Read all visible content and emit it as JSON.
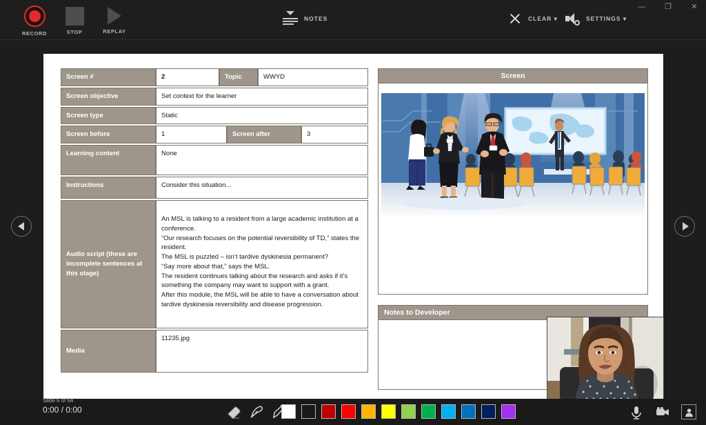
{
  "window": {
    "controls": [
      {
        "name": "minimize",
        "glyph": "—"
      },
      {
        "name": "restore",
        "glyph": "❐"
      },
      {
        "name": "close",
        "glyph": "✕"
      }
    ]
  },
  "toolbar": {
    "record_label": "RECORD",
    "stop_label": "STOP",
    "replay_label": "REPLAY",
    "notes_label": "NOTES",
    "clear_label": "CLEAR ▾",
    "settings_label": "SETTINGS ▾",
    "record_color": "#e8292b"
  },
  "navigation": {
    "prev_label": "Previous slide",
    "next_label": "Next slide"
  },
  "slide": {
    "spec_table": {
      "screen_number_label": "Screen #",
      "screen_number_value": "2",
      "topic_label": "Topic",
      "topic_value": "WWYD",
      "screen_objective_label": "Screen objective",
      "screen_objective_value": "Set context for the learner",
      "screen_type_label": "Screen type",
      "screen_type_value": "Static",
      "screen_before_label": "Screen before",
      "screen_before_value": "1",
      "screen_after_label": "Screen after",
      "screen_after_value": "3",
      "learning_content_label": "Learning content",
      "learning_content_value": "None",
      "instructions_label": "Instructions",
      "instructions_value": "Consider this situation...",
      "audio_script_label": "Audio script (these are incomplete sentences at this stage)",
      "audio_script_value": "An MSL is talking to a resident from a large academic institution at a conference.\n“Our research focuses on the potential reversibility of TD,” states the resident.\nThe MSL is puzzled – isn’t tardive dyskinesia permanent?\n“Say more about that,” says the MSL.\nThe resident continues talking about the research and asks if it’s something the company may want to support with a grant.\nAfter this module, the MSL will be able to have a conversation about tardive dyskinesia reversibility and disease progression.",
      "media_label": "Media",
      "media_value": "11235.jpg"
    },
    "screen_panel": {
      "title": "Screen",
      "illustration_alt": "conference-presentation-illustration"
    },
    "notes_panel": {
      "title": "Notes to Developer",
      "body": ""
    }
  },
  "webcam": {
    "label": "presenter-webcam-feed"
  },
  "statusbar": {
    "slide_counter": "Slide 6 of 64",
    "time_code": "0:00 / 0:00",
    "pen_tools": [
      {
        "name": "eraser-tool"
      },
      {
        "name": "pen-tool"
      },
      {
        "name": "highlighter-tool"
      }
    ],
    "colors": [
      {
        "name": "white",
        "hex": "#ffffff"
      },
      {
        "name": "black",
        "hex": "#1a1a1a"
      },
      {
        "name": "dark-red",
        "hex": "#c00000"
      },
      {
        "name": "red",
        "hex": "#ff0000"
      },
      {
        "name": "orange",
        "hex": "#ffb400"
      },
      {
        "name": "yellow",
        "hex": "#ffff00"
      },
      {
        "name": "light-green",
        "hex": "#92d050"
      },
      {
        "name": "green",
        "hex": "#00b050"
      },
      {
        "name": "light-blue",
        "hex": "#00b0f0"
      },
      {
        "name": "blue",
        "hex": "#0070c0"
      },
      {
        "name": "dark-blue",
        "hex": "#002060"
      },
      {
        "name": "purple",
        "hex": "#a62ef0"
      }
    ],
    "av_tools": [
      {
        "name": "microphone-toggle",
        "active": false
      },
      {
        "name": "camera-toggle",
        "active": false
      },
      {
        "name": "presenter-view-toggle",
        "active": true
      }
    ]
  }
}
